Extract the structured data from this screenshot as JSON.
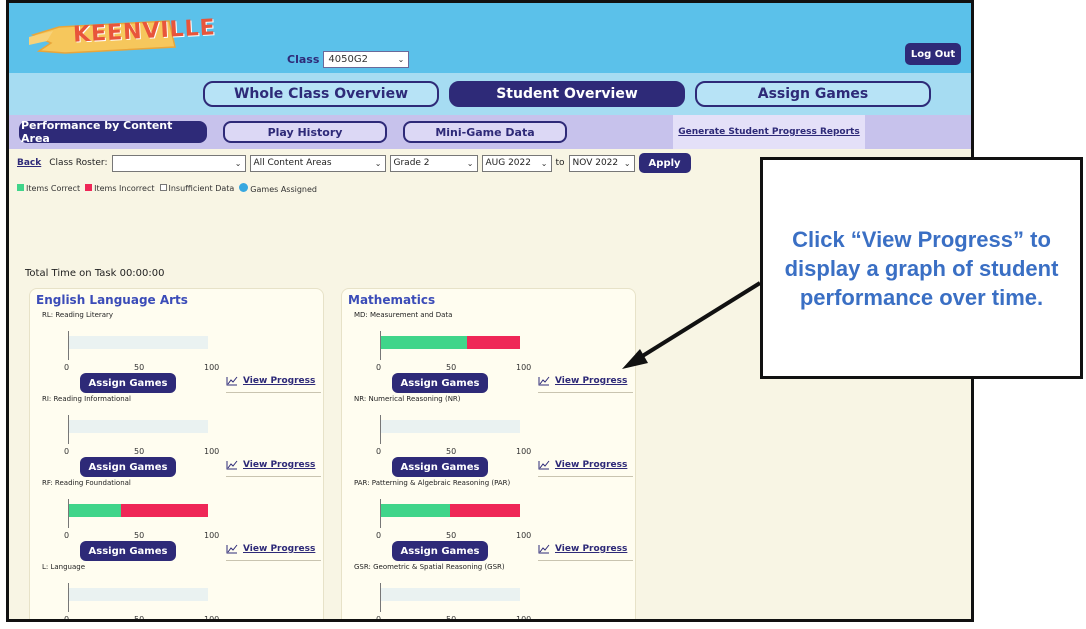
{
  "header": {
    "logo_text": "KEENVILLE",
    "class_label": "Class",
    "class_value": "4050G2",
    "logout_label": "Log Out"
  },
  "main_tabs": [
    {
      "label": "Whole Class Overview",
      "active": false
    },
    {
      "label": "Student Overview",
      "active": true
    },
    {
      "label": "Assign Games",
      "active": false
    }
  ],
  "sub_tabs": [
    {
      "label": "Performance by Content Area",
      "active": true
    },
    {
      "label": "Play History",
      "active": false
    },
    {
      "label": "Mini-Game Data",
      "active": false
    }
  ],
  "generate_report_label": "Generate Student Progress Reports",
  "filters": {
    "back_label": "Back",
    "roster_label": "Class Roster:",
    "roster_value": "",
    "content_area_value": "All Content Areas",
    "grade_value": "Grade 2",
    "from_value": "AUG 2022",
    "to_label": "to",
    "to_value": "NOV 2022",
    "apply_label": "Apply"
  },
  "legend": {
    "correct_label": "Items Correct",
    "incorrect_label": "Items Incorrect",
    "insufficient_label": "Insufficient Data",
    "games_assigned_label": "Games Assigned"
  },
  "colors": {
    "correct": "#40d58a",
    "incorrect": "#ef2757",
    "navy": "#2e2a78",
    "games_assigned": "#37a8e0",
    "callout_text": "#3a6fc4"
  },
  "total_time": "Total Time on Task 00:00:00",
  "axis_ticks": [
    "0",
    "50",
    "100"
  ],
  "assign_label": "Assign Games",
  "view_progress_label": "View Progress",
  "view_progress_icon": "line-chart-icon",
  "panels": [
    {
      "title": "English Language Arts",
      "sections": [
        {
          "label": "RL: Reading Literary",
          "correct_pct": 0,
          "incorrect_pct": 0
        },
        {
          "label": "RI: Reading Informational",
          "correct_pct": 0,
          "incorrect_pct": 0
        },
        {
          "label": "RF: Reading Foundational",
          "correct_pct": 38,
          "incorrect_pct": 62
        },
        {
          "label": "L: Language",
          "correct_pct": 0,
          "incorrect_pct": 0
        }
      ]
    },
    {
      "title": "Mathematics",
      "sections": [
        {
          "label": "MD: Measurement and Data",
          "correct_pct": 62,
          "incorrect_pct": 38
        },
        {
          "label": "NR: Numerical Reasoning (NR)",
          "correct_pct": 0,
          "incorrect_pct": 0
        },
        {
          "label": "PAR: Patterning & Algebraic Reasoning (PAR)",
          "correct_pct": 50,
          "incorrect_pct": 50
        },
        {
          "label": "GSR: Geometric & Spatial Reasoning (GSR)",
          "correct_pct": 0,
          "incorrect_pct": 0
        }
      ]
    }
  ],
  "callout_text": "Click “View Progress” to display a graph of student performance over time."
}
